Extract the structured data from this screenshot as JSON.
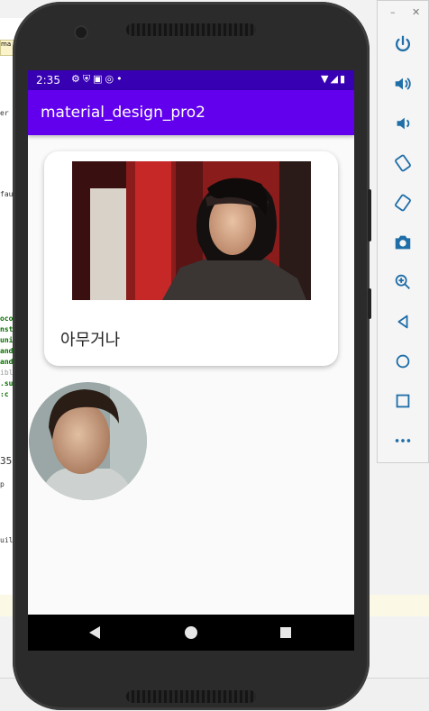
{
  "ide": {
    "tab_label": "ma",
    "snippets": [
      "er",
      "fau",
      "oco",
      "nst",
      "uni",
      "and",
      "and",
      "ibl",
      ".su",
      ":c",
      "35",
      "p",
      "uil"
    ]
  },
  "status_bar": {
    "time": "2:35",
    "left_icons": [
      "gear-icon",
      "shield-icon",
      "a-icon",
      "circle-icon",
      "dot"
    ],
    "right_icons": [
      "wifi-icon",
      "signal-icon",
      "battery-icon"
    ]
  },
  "app_bar": {
    "title": "material_design_pro2",
    "background": "#6200ee",
    "status_bar_color": "#3700b3"
  },
  "card": {
    "text": "아무거나"
  },
  "emulator_toolbar": {
    "window_controls": [
      "minimize",
      "close"
    ],
    "buttons": [
      "power-icon",
      "volume-up-icon",
      "volume-down-icon",
      "rotate-left-icon",
      "rotate-right-icon",
      "camera-icon",
      "zoom-icon",
      "back-icon",
      "home-icon",
      "overview-icon",
      "more-icon"
    ]
  }
}
